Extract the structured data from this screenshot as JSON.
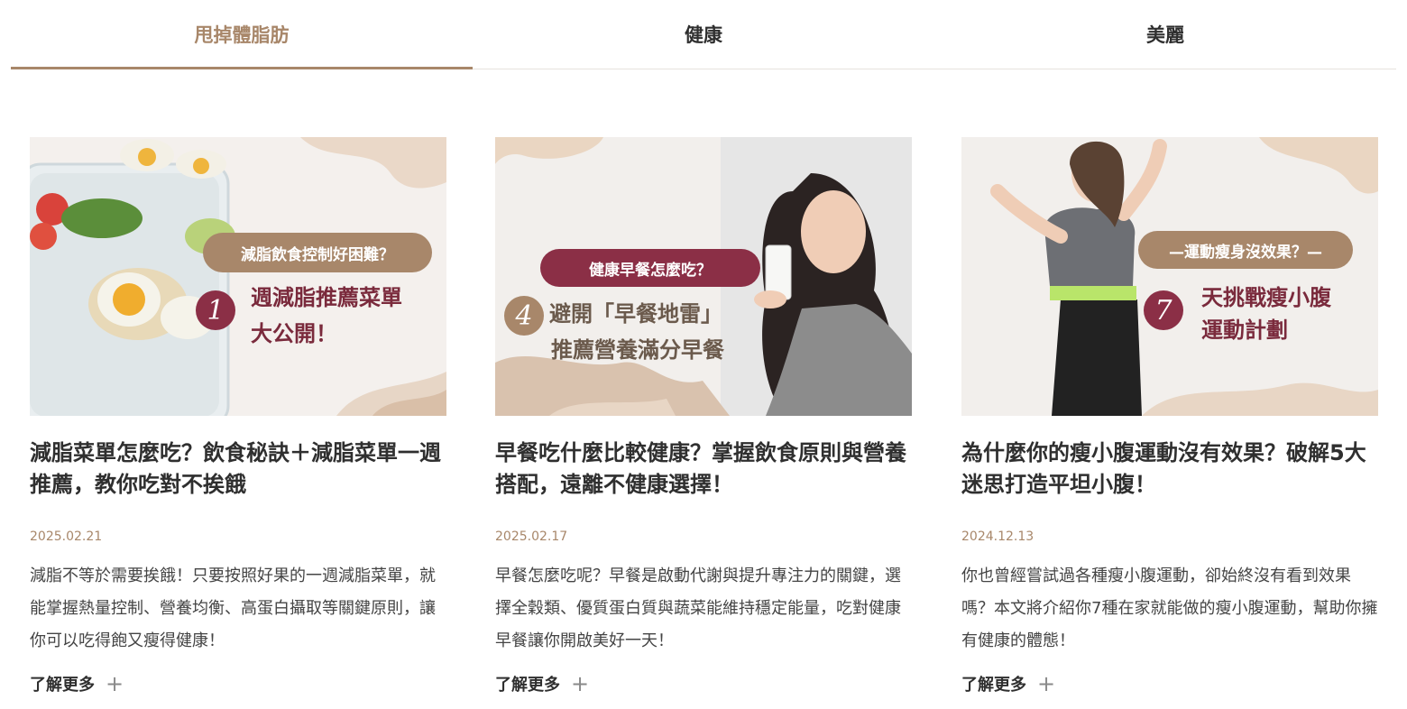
{
  "tabs": [
    {
      "label": "甩掉體脂肪",
      "active": true
    },
    {
      "label": "健康",
      "active": false
    },
    {
      "label": "美麗",
      "active": false
    }
  ],
  "colors": {
    "accent": "#a8876a",
    "pill": "#a8876a",
    "pill_alt": "#8b2f46",
    "headline": "#7a2a3c"
  },
  "cards": [
    {
      "thumb": {
        "pill": "減脂飲食控制好困難？",
        "number": "1",
        "line1": "週減脂推薦菜單",
        "line2": "大公開！"
      },
      "title": "減脂菜單怎麼吃？飲食秘訣＋減脂菜單一週推薦，教你吃對不挨餓",
      "date": "2025.02.21",
      "excerpt": "減脂不等於需要挨餓！只要按照好果的一週減脂菜單，就能掌握熱量控制、營養均衡、高蛋白攝取等關鍵原則，讓你可以吃得飽又瘦得健康！",
      "more": "了解更多",
      "more_icon": "plus-icon"
    },
    {
      "thumb": {
        "pill": "健康早餐怎麼吃？",
        "number": "4",
        "line1": "避開「早餐地雷」",
        "line2": "推薦營養滿分早餐"
      },
      "title": "早餐吃什麼比較健康？掌握飲食原則與營養搭配，遠離不健康選擇！",
      "date": "2025.02.17",
      "excerpt": "早餐怎麼吃呢？早餐是啟動代謝與提升專注力的關鍵，選擇全穀類、優質蛋白質與蔬菜能維持穩定能量，吃對健康早餐讓你開啟美好一天！",
      "more": "了解更多",
      "more_icon": "plus-icon"
    },
    {
      "thumb": {
        "pill": "—運動瘦身沒效果？—",
        "number": "7",
        "line1": "天挑戰瘦小腹",
        "line2": "運動計劃"
      },
      "title": "為什麼你的瘦小腹運動沒有效果？破解5大迷思打造平坦小腹！",
      "date": "2024.12.13",
      "excerpt": "你也曾經嘗試過各種瘦小腹運動，卻始終沒有看到效果嗎？本文將介紹你7種在家就能做的瘦小腹運動，幫助你擁有健康的體態！",
      "more": "了解更多",
      "more_icon": "plus-icon"
    }
  ]
}
